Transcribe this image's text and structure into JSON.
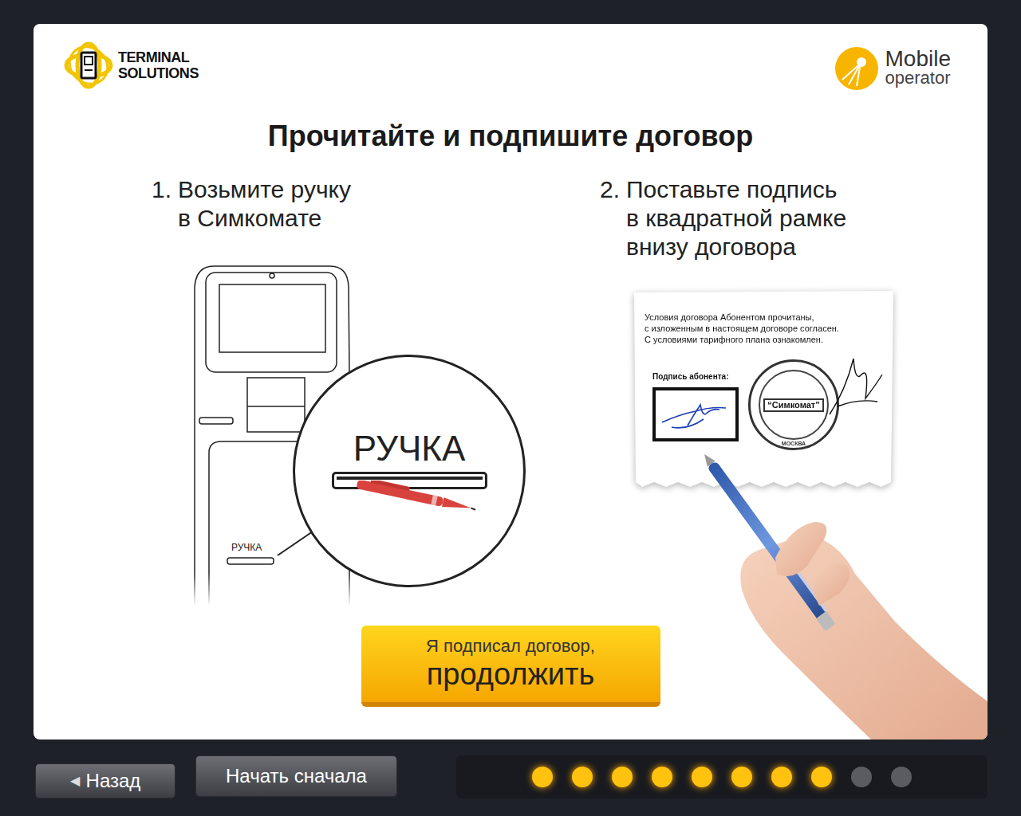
{
  "header": {
    "brand_left": {
      "lines": [
        "TERMINAL",
        "SOLUTIONS"
      ]
    },
    "brand_right": {
      "name": "Mobile",
      "subtitle": "operator"
    }
  },
  "title": "Прочитайте и подпишите договор",
  "steps": [
    {
      "number": "1.",
      "lines": [
        "Возьмите ручку",
        "в Симкомате"
      ]
    },
    {
      "number": "2.",
      "lines": [
        "Поставьте подпись",
        "в квадратной рамке",
        "внизу договора"
      ]
    }
  ],
  "kiosk": {
    "slot_label": "РУЧКА",
    "zoom_label": "РУЧКА"
  },
  "contract": {
    "lines": [
      "Условия договора Абонентом прочитаны,",
      "с изложенным в настоящем договоре согласен.",
      "С условиями тарифного плана ознакомлен."
    ],
    "signature_label": "Подпись абонента:",
    "signed": true,
    "stamp": {
      "name": "“Симкомат”",
      "city": "МОСКВА"
    }
  },
  "continue_button": {
    "lines": [
      "Я подписал договор,",
      "продолжить"
    ]
  },
  "nav": {
    "back": {
      "icon": "◀",
      "label": "Назад"
    },
    "restart": {
      "label": "Начать сначала"
    }
  },
  "progress": {
    "steps": [
      {
        "done": true
      },
      {
        "done": true
      },
      {
        "done": true
      },
      {
        "done": true
      },
      {
        "done": true
      },
      {
        "done": true
      },
      {
        "done": true
      },
      {
        "done": true
      },
      {
        "done": false
      },
      {
        "done": false
      }
    ]
  }
}
